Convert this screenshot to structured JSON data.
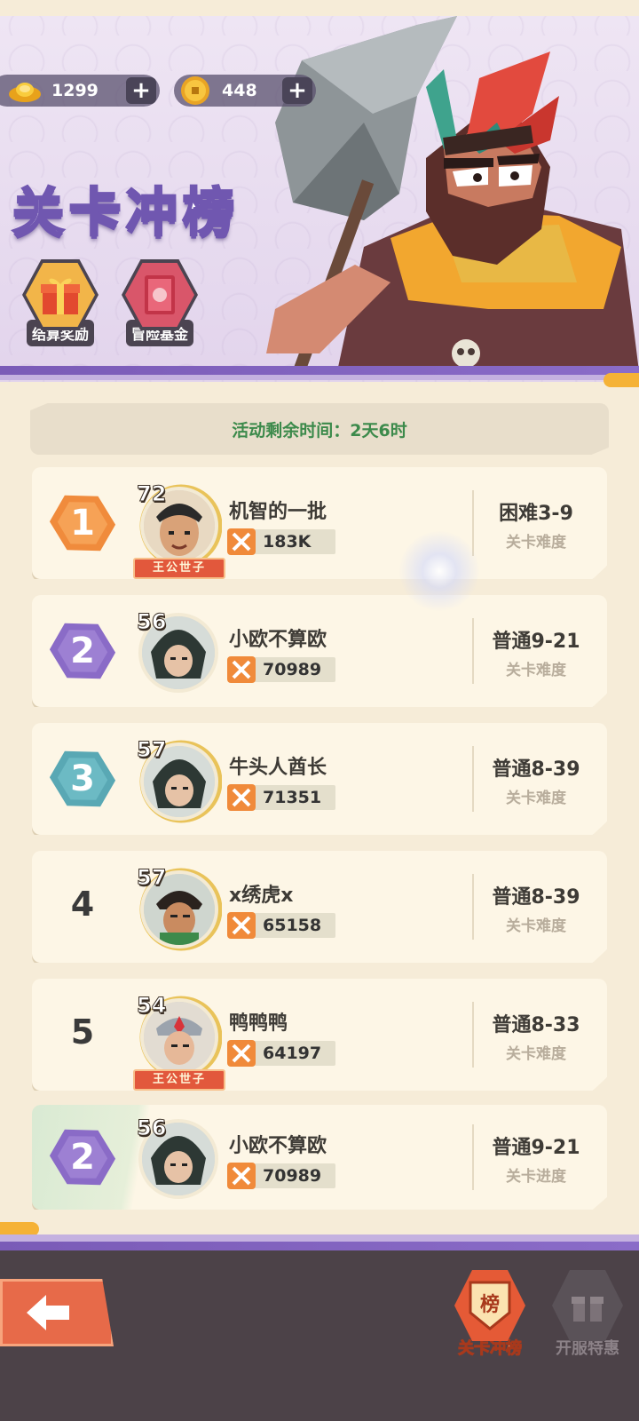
{
  "currency": {
    "gold": "1299",
    "coin": "448",
    "plus": "+"
  },
  "event": {
    "title": "关卡冲榜",
    "reward_label": "结算奖励",
    "fund_label": "冒险基金",
    "timer_text": "活动剩余时间：2天6时"
  },
  "rankings": [
    {
      "rank": "1",
      "level": "72",
      "name": "机智的一批",
      "power": "183K",
      "stage": "困难3-9",
      "stage_label": "关卡难度",
      "title": "王公世子"
    },
    {
      "rank": "2",
      "level": "56",
      "name": "小欧不算欧",
      "power": "70989",
      "stage": "普通9-21",
      "stage_label": "关卡难度"
    },
    {
      "rank": "3",
      "level": "57",
      "name": "牛头人酋长",
      "power": "71351",
      "stage": "普通8-39",
      "stage_label": "关卡难度"
    },
    {
      "rank": "4",
      "level": "57",
      "name": "x绣虎x",
      "power": "65158",
      "stage": "普通8-39",
      "stage_label": "关卡难度"
    },
    {
      "rank": "5",
      "level": "54",
      "name": "鸭鸭鸭",
      "power": "64197",
      "stage": "普通8-33",
      "stage_label": "关卡难度",
      "title": "王公世子"
    }
  ],
  "self": {
    "rank": "2",
    "level": "56",
    "name": "小欧不算欧",
    "power": "70989",
    "stage": "普通9-21",
    "stage_label": "关卡进度"
  },
  "nav": {
    "rank_label": "关卡冲榜",
    "rank_icon_text": "榜",
    "gift_label": "开服特惠"
  },
  "colors": {
    "rank1": "#f08b3c",
    "rank2": "#8a6bc7",
    "rank3": "#59a8b4",
    "accent_purple": "#7a5bb7",
    "timer_green": "#3c8a4b"
  },
  "icons": {
    "gold": "gold-ingot-icon",
    "coin": "copper-coin-icon",
    "power": "crossed-swords-icon",
    "back": "back-arrow-icon",
    "gift": "gift-box-icon"
  }
}
